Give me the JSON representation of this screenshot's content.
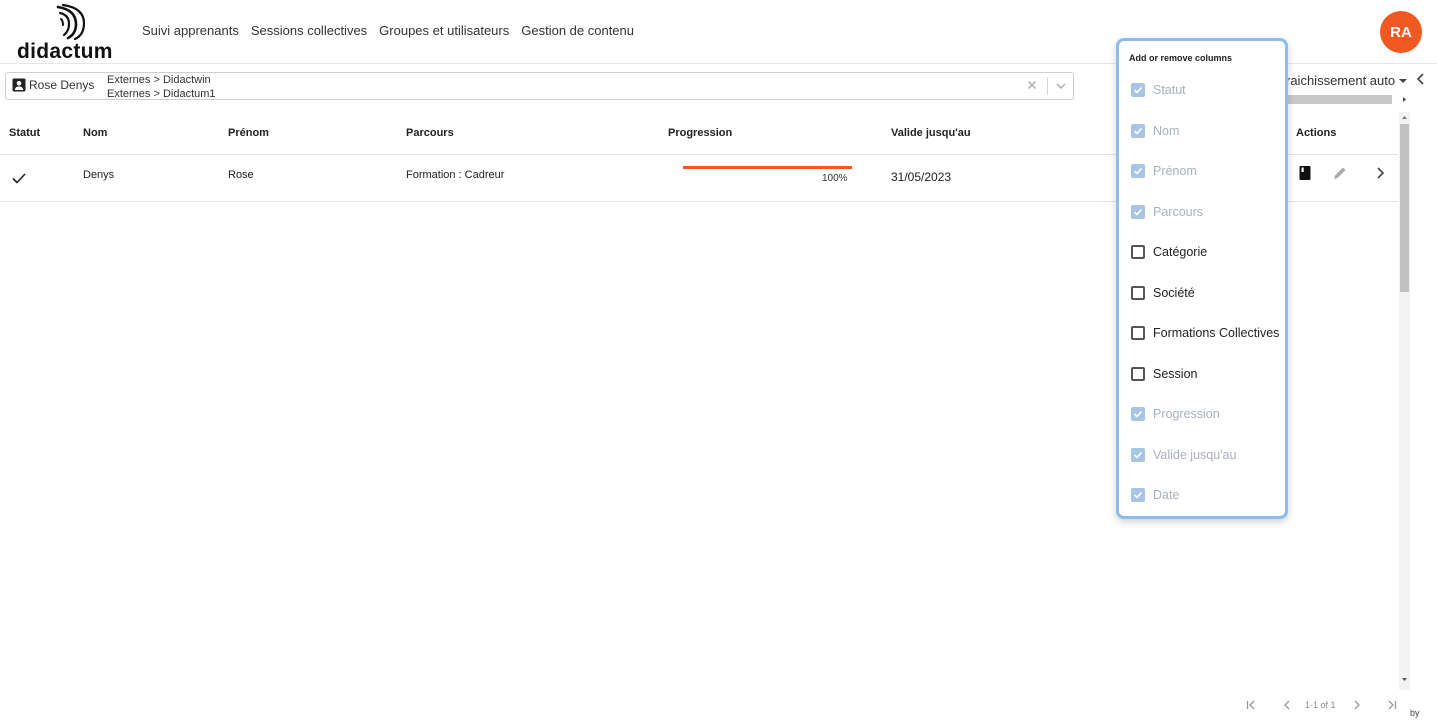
{
  "app": {
    "logo_text": "didactum",
    "accent": "#f05a22"
  },
  "nav": {
    "items": [
      {
        "label": "Suivi apprenants"
      },
      {
        "label": "Sessions collectives"
      },
      {
        "label": "Groupes et utilisateurs"
      },
      {
        "label": "Gestion de contenu"
      }
    ]
  },
  "user": {
    "initials": "RA"
  },
  "filter": {
    "user_name": "Rose Denys",
    "paths": [
      "Externes > Didactwin",
      "Externes > Didactum1"
    ]
  },
  "refresh": {
    "label": "raichissement auto"
  },
  "table": {
    "headers": [
      "Statut",
      "Nom",
      "Prénom",
      "Parcours",
      "Progression",
      "Valide jusqu'au",
      "Actions"
    ],
    "rows": [
      {
        "nom": "Denys",
        "prenom": "Rose",
        "parcours": "Formation : Cadreur",
        "progression_label": "100%",
        "progression": 100,
        "valide": "31/05/2023"
      }
    ]
  },
  "column_popup": {
    "title": "Add or remove columns",
    "options": [
      {
        "label": "Statut",
        "checked": true,
        "disabled": true
      },
      {
        "label": "Nom",
        "checked": true,
        "disabled": true
      },
      {
        "label": "Prénom",
        "checked": true,
        "disabled": true
      },
      {
        "label": "Parcours",
        "checked": true,
        "disabled": true
      },
      {
        "label": "Catégorie",
        "checked": false,
        "disabled": false
      },
      {
        "label": "Société",
        "checked": false,
        "disabled": false
      },
      {
        "label": "Formations Collectives",
        "checked": false,
        "disabled": false
      },
      {
        "label": "Session",
        "checked": false,
        "disabled": false
      },
      {
        "label": "Progression",
        "checked": true,
        "disabled": true
      },
      {
        "label": "Valide jusqu'au",
        "checked": true,
        "disabled": true
      },
      {
        "label": "Date",
        "checked": true,
        "disabled": true
      }
    ]
  },
  "pagination": {
    "label": "1-1 of 1"
  },
  "footer": {
    "by": "by"
  }
}
